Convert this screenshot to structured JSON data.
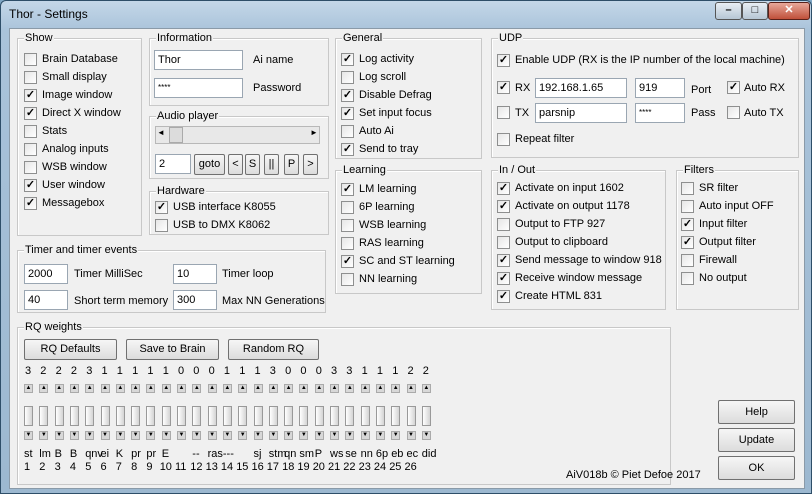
{
  "window": {
    "title": "Thor - Settings",
    "minimize": "–",
    "maximize": "□",
    "close": "✕"
  },
  "show": {
    "legend": "Show",
    "items": [
      {
        "label": "Brain Database",
        "checked": false
      },
      {
        "label": "Small display",
        "checked": false
      },
      {
        "label": "Image window",
        "checked": true
      },
      {
        "label": "Direct X window",
        "checked": true
      },
      {
        "label": "Stats",
        "checked": false
      },
      {
        "label": "Analog inputs",
        "checked": false
      },
      {
        "label": "WSB window",
        "checked": false
      },
      {
        "label": "User window",
        "checked": true
      },
      {
        "label": "Messagebox",
        "checked": true
      }
    ]
  },
  "information": {
    "legend": "Information",
    "ai_name_value": "Thor",
    "ai_name_label": "Ai name",
    "password_value": "****",
    "password_label": "Password"
  },
  "audio": {
    "legend": "Audio player",
    "left_arrow": "◄",
    "right_arrow": "►",
    "track_value": "2",
    "goto": "goto",
    "prev": "<",
    "stop": "S",
    "pause": "||",
    "play": "P",
    "next": ">"
  },
  "hardware": {
    "legend": "Hardware",
    "items": [
      {
        "label": "USB interface K8055",
        "checked": true
      },
      {
        "label": "USB to DMX K8062",
        "checked": false
      }
    ]
  },
  "general": {
    "legend": "General",
    "items": [
      {
        "label": "Log activity",
        "checked": true
      },
      {
        "label": "Log scroll",
        "checked": false
      },
      {
        "label": "Disable Defrag",
        "checked": true
      },
      {
        "label": "Set input focus",
        "checked": true
      },
      {
        "label": "Auto Ai",
        "checked": false
      },
      {
        "label": "Send to tray",
        "checked": true
      }
    ]
  },
  "learning": {
    "legend": "Learning",
    "items": [
      {
        "label": "LM learning",
        "checked": true
      },
      {
        "label": "6P learning",
        "checked": false
      },
      {
        "label": "WSB learning",
        "checked": false
      },
      {
        "label": "RAS learning",
        "checked": false
      },
      {
        "label": "SC and ST learning",
        "checked": true
      },
      {
        "label": "NN learning",
        "checked": false
      }
    ]
  },
  "udp": {
    "legend": "UDP",
    "enable_label": "Enable UDP (RX is the IP number of the local machine)",
    "enable_checked": true,
    "rx_label": "RX",
    "rx_checked": true,
    "rx_ip": "192.168.1.65",
    "rx_port": "919",
    "port_label": "Port",
    "auto_rx_label": "Auto RX",
    "auto_rx_checked": true,
    "tx_label": "TX",
    "tx_checked": false,
    "tx_host": "parsnip",
    "tx_pass": "****",
    "pass_label": "Pass",
    "auto_tx_label": "Auto TX",
    "auto_tx_checked": false,
    "repeat_label": "Repeat filter",
    "repeat_checked": false
  },
  "inout": {
    "legend": "In / Out",
    "items": [
      {
        "label": "Activate on input 1602",
        "checked": true
      },
      {
        "label": "Activate on output 1178",
        "checked": true
      },
      {
        "label": "Output to FTP 927",
        "checked": false
      },
      {
        "label": "Output to clipboard",
        "checked": false
      },
      {
        "label": "Send message to window 918",
        "checked": true
      },
      {
        "label": "Receive window message",
        "checked": true
      },
      {
        "label": "Create HTML 831",
        "checked": true
      }
    ]
  },
  "filters": {
    "legend": "Filters",
    "items": [
      {
        "label": "SR filter",
        "checked": false
      },
      {
        "label": "Auto input OFF",
        "checked": false
      },
      {
        "label": "Input filter",
        "checked": true
      },
      {
        "label": "Output filter",
        "checked": true
      },
      {
        "label": "Firewall",
        "checked": false
      },
      {
        "label": "No output",
        "checked": false
      }
    ]
  },
  "timer": {
    "legend": "Timer and timer events",
    "millisec_value": "2000",
    "millisec_label": "Timer MilliSec",
    "loop_value": "10",
    "loop_label": "Timer loop",
    "stm_value": "40",
    "stm_label": "Short term memory",
    "nn_value": "300",
    "nn_label": "Max NN Generations"
  },
  "rq": {
    "legend": "RQ weights",
    "defaults": "RQ Defaults",
    "save": "Save to Brain",
    "random": "Random RQ",
    "weights": [
      "3",
      "2",
      "2",
      "2",
      "3",
      "1",
      "1",
      "1",
      "1",
      "1",
      "0",
      "0",
      "0",
      "1",
      "1",
      "1",
      "3",
      "0",
      "0",
      "0",
      "3",
      "3",
      "1",
      "1",
      "1",
      "2",
      "2"
    ],
    "names": [
      "st",
      "lm",
      "B",
      "B",
      "qnv",
      "ei",
      "K",
      "pr",
      "pr",
      "E",
      "",
      "--",
      "ras",
      "---",
      "",
      "sj",
      "stm",
      "qn",
      "sm",
      "P",
      "ws",
      "se",
      "nn",
      "6p",
      "eb",
      "ec",
      "did"
    ],
    "numbers": [
      "1",
      "2",
      "3",
      "4",
      "5",
      "6",
      "7",
      "8",
      "9",
      "10",
      "11",
      "12",
      "13",
      "14",
      "15",
      "16",
      "17",
      "18",
      "19",
      "20",
      "21",
      "22",
      "23",
      "24",
      "25",
      "26"
    ]
  },
  "footer": {
    "version": "AiV018b © Piet Defoe 2017",
    "help": "Help",
    "update": "Update",
    "ok": "OK"
  }
}
